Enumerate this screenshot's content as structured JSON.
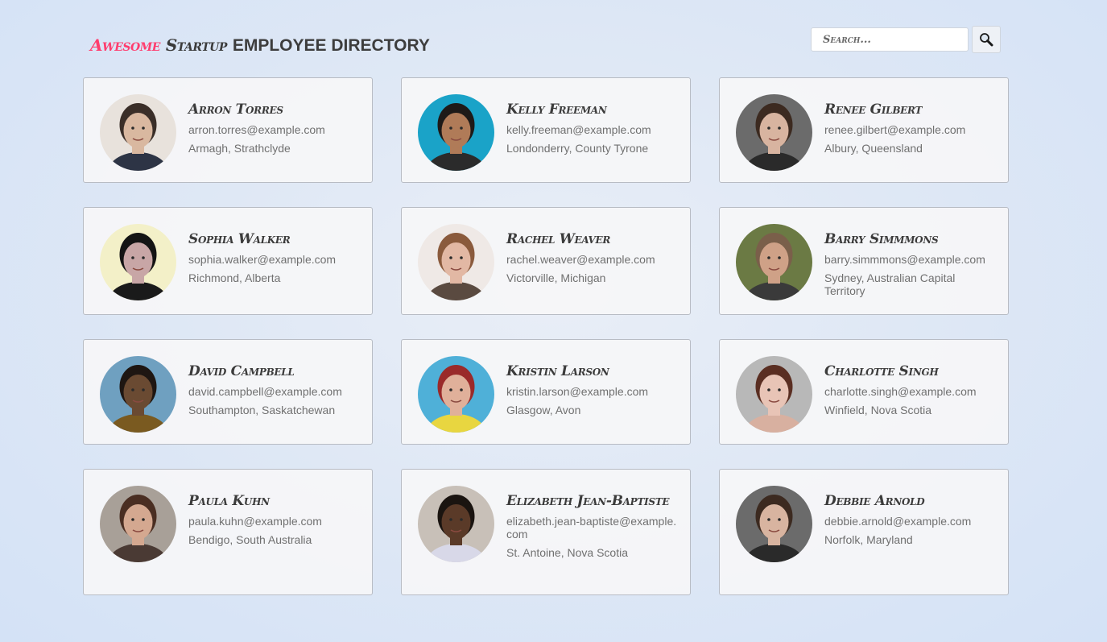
{
  "header": {
    "title_awesome": "Awesome",
    "title_startup": "Startup",
    "title_rest": "EMPLOYEE DIRECTORY",
    "search_placeholder": "Search...",
    "search_icon": "magnifier-icon"
  },
  "employees": [
    {
      "name": "Arron Torres",
      "email": "arron.torres@example.com",
      "location": "Armagh, Strathclyde",
      "bg": "#e8e2dc",
      "skin": "#d9b8a0",
      "hair": "#3a2e28",
      "shirt": "#2d3445"
    },
    {
      "name": "Kelly Freeman",
      "email": "kelly.freeman@example.com",
      "location": "Londonderry, County Tyrone",
      "bg": "#1aa3c8",
      "skin": "#b07b58",
      "hair": "#1e1a18",
      "shirt": "#2b2b2b"
    },
    {
      "name": "Renee Gilbert",
      "email": "renee.gilbert@example.com",
      "location": "Albury, Queensland",
      "bg": "#6b6b6b",
      "skin": "#d8b4a0",
      "hair": "#3c2a20",
      "shirt": "#2a2a2a"
    },
    {
      "name": "Sophia Walker",
      "email": "sophia.walker@example.com",
      "location": "Richmond, Alberta",
      "bg": "#f3f0c8",
      "skin": "#c8a6a6",
      "hair": "#141414",
      "shirt": "#1a1a1a"
    },
    {
      "name": "Rachel Weaver",
      "email": "rachel.weaver@example.com",
      "location": "Victorville, Michigan",
      "bg": "#efe9e6",
      "skin": "#e2b8a4",
      "hair": "#8a5a3c",
      "shirt": "#5a4a40"
    },
    {
      "name": "Barry Simmmons",
      "email": "barry.simmmons@example.com",
      "location": "Sydney, Australian Capital Territory",
      "bg": "#6b7a44",
      "skin": "#cfa187",
      "hair": "#7a5f4a",
      "shirt": "#3a3a3a"
    },
    {
      "name": "David Campbell",
      "email": "david.campbell@example.com",
      "location": "Southampton, Saskatchewan",
      "bg": "#6fa0c0",
      "skin": "#6a4a32",
      "hair": "#1e1612",
      "shirt": "#7a5a20"
    },
    {
      "name": "Kristin Larson",
      "email": "kristin.larson@example.com",
      "location": "Glasgow, Avon",
      "bg": "#4fb0d8",
      "skin": "#e0b09a",
      "hair": "#9a2a2a",
      "shirt": "#e8d640"
    },
    {
      "name": "Charlotte Singh",
      "email": "charlotte.singh@example.com",
      "location": "Winfield, Nova Scotia",
      "bg": "#b8b8b8",
      "skin": "#e8c4b6",
      "hair": "#5a2e22",
      "shirt": "#d8b0a0"
    },
    {
      "name": "Paula Kuhn",
      "email": "paula.kuhn@example.com",
      "location": "Bendigo, South Australia",
      "bg": "#a8a098",
      "skin": "#d4a890",
      "hair": "#4a2e22",
      "shirt": "#4a3a34"
    },
    {
      "name": "Elizabeth Jean-Baptiste",
      "email": "elizabeth.jean-baptiste@example.com",
      "location": "St. Antoine, Nova Scotia",
      "bg": "#c8c0b8",
      "skin": "#5a3a28",
      "hair": "#1a1410",
      "shirt": "#d8d8e8"
    },
    {
      "name": "Debbie Arnold",
      "email": "debbie.arnold@example.com",
      "location": "Norfolk, Maryland",
      "bg": "#6b6b6b",
      "skin": "#d8b4a0",
      "hair": "#3c2a20",
      "shirt": "#2a2a2a"
    }
  ]
}
